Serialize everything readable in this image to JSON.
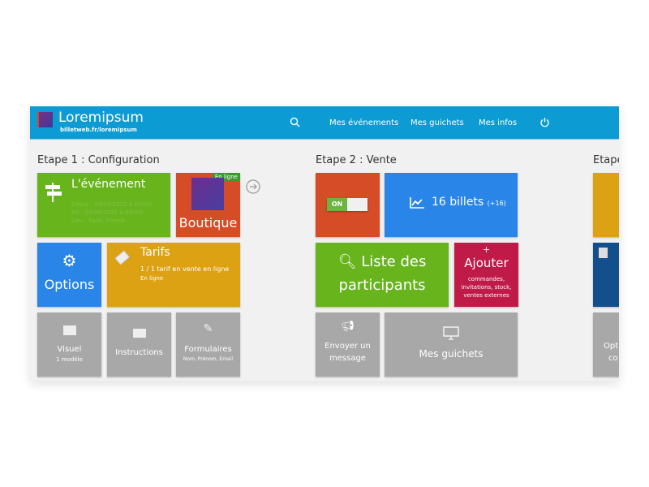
{
  "header": {
    "brand": "Loremipsum",
    "url": "billetweb.fr/loremipsum",
    "nav": [
      "Mes événements",
      "Mes guichets",
      "Mes infos"
    ],
    "icons": [
      "search-icon",
      "power-icon"
    ]
  },
  "step1": {
    "title": "Etape 1 : Configuration",
    "event": {
      "title": "L'événement",
      "start": "Début : 04/05/2022 à 20h00",
      "end": "Fin : 05/05/2022 à 04h00",
      "place": "Lieu : Paris, France"
    },
    "shop": {
      "badge": "En ligne",
      "label": "Boutique"
    },
    "options": "Options",
    "tarifs": {
      "title": "Tarifs",
      "line1": "1 / 1 tarif en vente en ligne",
      "line2": "En ligne"
    },
    "visuel": {
      "title": "Visuel",
      "sub": "1 modèle"
    },
    "instructions": "Instructions",
    "formulaires": {
      "title": "Formulaires",
      "sub": "Nom, Prénom, Email"
    }
  },
  "step2": {
    "title": "Etape 2 : Vente",
    "toggle": "ON",
    "toggle_on": true,
    "tickets": "16 billets",
    "tickets_delta": "(+16)",
    "participants": "Liste des participants",
    "add": {
      "plus": "+",
      "title": "Ajouter",
      "sub": "commandes, invitations, stock, ventes externes"
    },
    "message": "Envoyer un message",
    "guichets": "Mes guichets"
  },
  "step3": {
    "title": "Etape",
    "opt_partial": "Opti",
    "opt_partial2": "co"
  },
  "colors": {
    "header": "#0d9bd3",
    "green": "#67b41d",
    "red": "#d64c26",
    "blue": "#2a85e8",
    "yellow": "#dda114",
    "gray": "#a8a8a8",
    "crimson": "#c01a48",
    "navy": "#124f8c"
  }
}
